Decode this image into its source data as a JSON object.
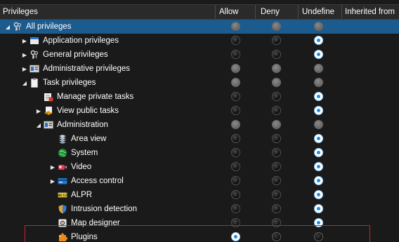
{
  "columns": {
    "privileges": "Privileges",
    "allow": "Allow",
    "deny": "Deny",
    "undefine": "Undefine",
    "inherited": "Inherited from"
  },
  "rows": [
    {
      "label": "All privileges",
      "icon": "keys-icon",
      "expander": "expanded",
      "selected": true,
      "allow": "gray",
      "deny": "gray",
      "undefine": "gray"
    },
    {
      "label": "Application privileges",
      "icon": "application-window-icon",
      "expander": "collapsed",
      "allow": "black",
      "deny": "black",
      "undefine": "blue"
    },
    {
      "label": "General privileges",
      "icon": "keys-icon",
      "expander": "collapsed",
      "allow": "black",
      "deny": "black",
      "undefine": "blue"
    },
    {
      "label": "Administrative privileges",
      "icon": "admin-panel-icon",
      "expander": "collapsed",
      "allow": "gray",
      "deny": "gray",
      "undefine": "gray"
    },
    {
      "label": "Task privileges",
      "icon": "clipboard-icon",
      "expander": "expanded",
      "allow": "gray",
      "deny": "gray",
      "undefine": "gray"
    },
    {
      "label": "Manage private tasks",
      "icon": "private-task-icon",
      "expander": "none",
      "allow": "black",
      "deny": "black",
      "undefine": "blue"
    },
    {
      "label": "View public tasks",
      "icon": "public-task-icon",
      "expander": "collapsed",
      "allow": "black",
      "deny": "black",
      "undefine": "blue"
    },
    {
      "label": "Administration",
      "icon": "admin-panel-icon",
      "expander": "expanded",
      "allow": "gray",
      "deny": "gray",
      "undefine": "gray"
    },
    {
      "label": "Area view",
      "icon": "area-view-icon",
      "expander": "none",
      "allow": "black",
      "deny": "black",
      "undefine": "blue"
    },
    {
      "label": "System",
      "icon": "globe-icon",
      "expander": "none",
      "allow": "black",
      "deny": "black",
      "undefine": "blue"
    },
    {
      "label": "Video",
      "icon": "camera-icon",
      "expander": "collapsed",
      "allow": "black",
      "deny": "black",
      "undefine": "blue"
    },
    {
      "label": "Access control",
      "icon": "card-reader-icon",
      "expander": "collapsed",
      "allow": "black",
      "deny": "black",
      "undefine": "blue"
    },
    {
      "label": "ALPR",
      "icon": "license-plate-icon",
      "expander": "none",
      "allow": "black",
      "deny": "black",
      "undefine": "blue"
    },
    {
      "label": "Intrusion detection",
      "icon": "shield-icon",
      "expander": "none",
      "allow": "black",
      "deny": "black",
      "undefine": "blue"
    },
    {
      "label": "Map designer",
      "icon": "map-designer-icon",
      "expander": "none",
      "allow": "black",
      "deny": "black",
      "undefine": "blue"
    },
    {
      "label": "Plugins",
      "icon": "puzzle-icon",
      "expander": "none",
      "allow": "blue",
      "deny": "dark",
      "undefine": "dark"
    }
  ],
  "colors": {
    "selected_row": "#1c5b8e",
    "highlight_border": "#d21d2a",
    "radio_checked": "#1b8fe6"
  }
}
